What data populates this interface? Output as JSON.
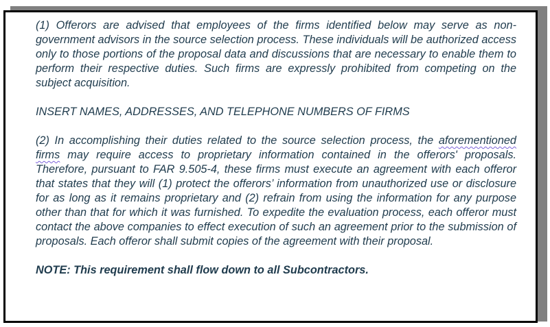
{
  "document": {
    "paragraph1": "(1) Offerors are advised that employees of the firms identified below may serve as non-government advisors in the source selection process. These individuals will be authorized access only to those portions of the proposal data and discussions that are necessary to enable them to perform their respective duties. Such firms are expressly prohibited from competing on the subject acquisition.",
    "insert_line": "INSERT NAMES, ADDRESSES, AND TELEPHONE NUMBERS OF FIRMS",
    "paragraph2_start": "(2) In accomplishing their duties related to the source selection process, the ",
    "paragraph2_flagged": "aforementioned firms",
    "paragraph2_rest": " may require access to proprietary information contained in the offerors' proposals. Therefore, pursuant to FAR 9.505-4, these firms must execute an agreement with each offeror that states that they will (1) protect the offerors’ information from unauthorized  use or disclosure for as long as it remains proprietary and (2) refrain from using the information for any purpose other than that for which it was furnished. To expedite the evaluation process, each offeror must contact the above companies to effect execution of such an agreement prior to the submission of proposals. Each offeror shall submit copies of the agreement with their proposal.",
    "note": "NOTE:  This requirement shall flow down to all Subcontractors."
  },
  "colors": {
    "text": "#1f3b4d",
    "border": "#000000",
    "shadow": "#808080",
    "spellcheck": "#7b61d9"
  }
}
